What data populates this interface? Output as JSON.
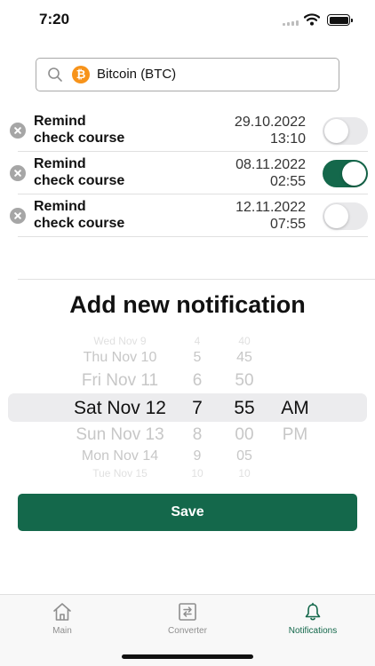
{
  "status_bar": {
    "time": "7:20"
  },
  "coin_selector": {
    "name": "Bitcoin (BTC)",
    "icon": "bitcoin-icon",
    "icon_glyph": "₿"
  },
  "reminders": [
    {
      "title": "Remind",
      "subtitle": "check course",
      "date": "29.10.2022",
      "time": "13:10",
      "enabled": false
    },
    {
      "title": "Remind",
      "subtitle": "check course",
      "date": "08.11.2022",
      "time": "02:55",
      "enabled": true
    },
    {
      "title": "Remind",
      "subtitle": "check course",
      "date": "12.11.2022",
      "time": "07:55",
      "enabled": false
    }
  ],
  "add_section": {
    "title": "Add new notification"
  },
  "picker": {
    "days": [
      "Wed Nov 9",
      "Thu Nov 10",
      "Fri Nov 11",
      "Sat Nov 12",
      "Sun Nov 13",
      "Mon Nov 14",
      "Tue Nov 15"
    ],
    "hours": [
      "4",
      "5",
      "6",
      "7",
      "8",
      "9",
      "10"
    ],
    "minutes": [
      "40",
      "45",
      "50",
      "55",
      "00",
      "05",
      "10"
    ],
    "periods": [
      "AM",
      "PM"
    ],
    "selected": {
      "day": "Sat Nov 12",
      "hour": "7",
      "minute": "55",
      "period": "AM"
    }
  },
  "save_button": {
    "label": "Save"
  },
  "tab_bar": {
    "tabs": [
      {
        "label": "Main",
        "icon": "home-icon",
        "active": false
      },
      {
        "label": "Converter",
        "icon": "converter-icon",
        "active": false
      },
      {
        "label": "Notifications",
        "icon": "bell-icon",
        "active": true
      }
    ]
  },
  "colors": {
    "accent": "#14684b",
    "bitcoin": "#f7931a",
    "toggle_off": "#e9e9eb",
    "inactive_tab": "#8e8e8e"
  }
}
